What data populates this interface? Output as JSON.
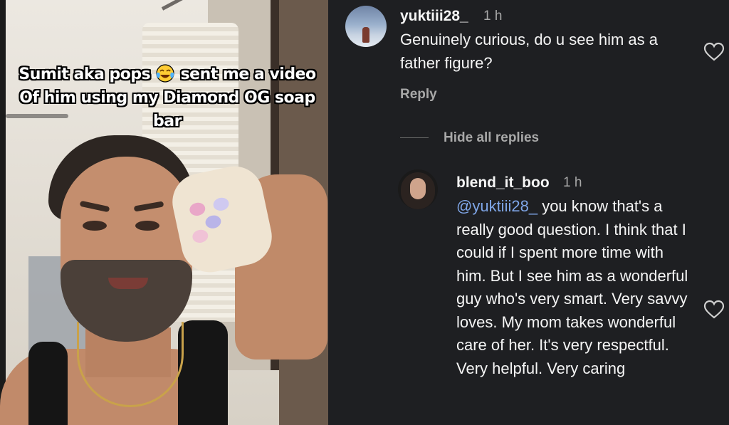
{
  "video": {
    "caption_line1_before": "Sumit aka pops",
    "caption_line1_after": "sent me a video",
    "caption_line2": "Of him using my Diamond OG soap bar",
    "emoji_icon": "tears-of-joy-emoji"
  },
  "comments": {
    "parent": {
      "username": "yuktiii28_",
      "time": "1 h",
      "text": "Genuinely curious, do u see him as a father figure?",
      "reply_label": "Reply"
    },
    "hide_replies_label": "Hide all replies",
    "reply": {
      "username": "blend_it_boo",
      "time": "1 h",
      "mention": "@yuktiii28_",
      "text": "you know that's a really good question. I think that I could if I spent more time with him. But I see him as a wonderful guy who's very smart. Very savvy loves. My mom takes wonderful care of her. It's very respectful. Very helpful. Very caring"
    }
  },
  "colors": {
    "panel_bg": "#1e1f22",
    "mention": "#7fa6e8",
    "muted_text": "#a8a8a8"
  }
}
